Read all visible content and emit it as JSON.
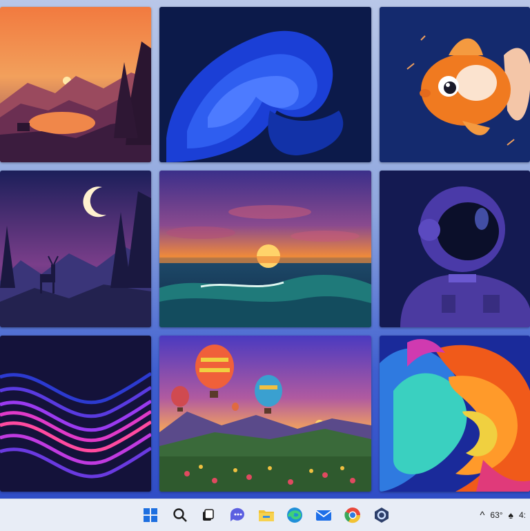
{
  "wallpapers": [
    {
      "name": "mountain-lake-sunset"
    },
    {
      "name": "blue-bloom-abstract"
    },
    {
      "name": "goldfish-space"
    },
    {
      "name": "deer-moonlit-forest"
    },
    {
      "name": "ocean-wave-sunset"
    },
    {
      "name": "astronaut-portrait"
    },
    {
      "name": "purple-wave-lines"
    },
    {
      "name": "hot-air-balloons"
    },
    {
      "name": "colorful-swirl"
    }
  ],
  "taskbar": {
    "icons": [
      "windows-start-icon",
      "search-icon",
      "task-view-icon",
      "chat-icon",
      "file-explorer-icon",
      "edge-icon",
      "mail-icon",
      "chrome-icon",
      "settings-icon"
    ]
  },
  "tray": {
    "chevron": "^",
    "temperature": "63°",
    "time": "4:"
  },
  "colors": {
    "taskbar_bg": "#e8edf6",
    "accent_blue": "#2f5ee0"
  }
}
